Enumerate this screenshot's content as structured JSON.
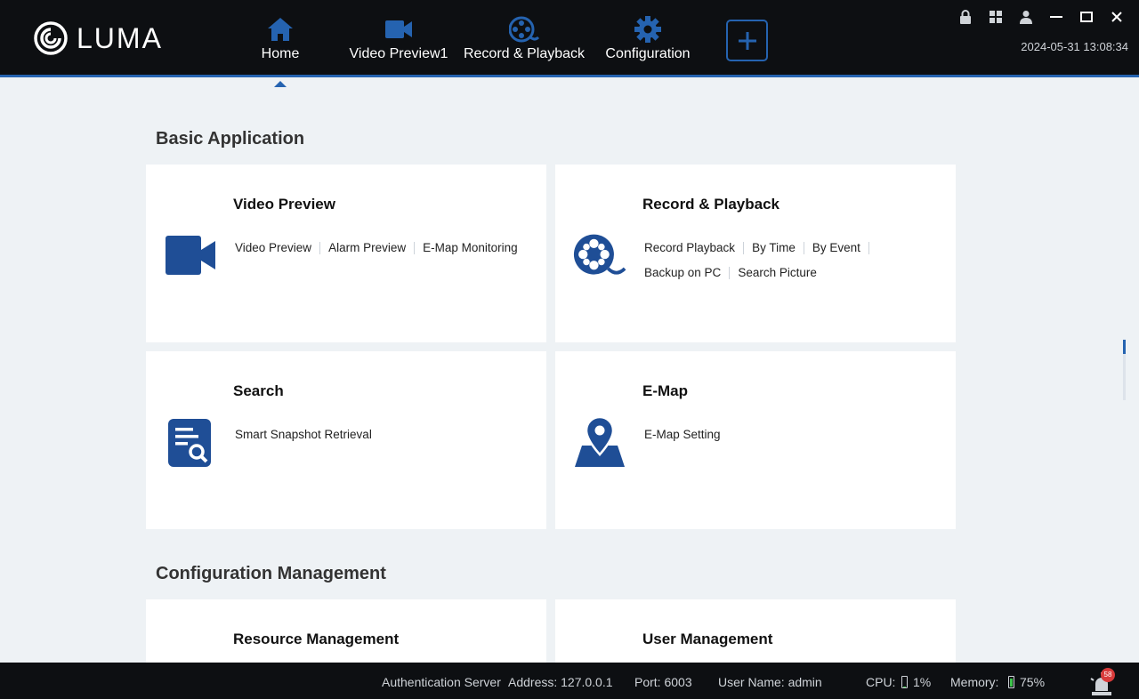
{
  "app": {
    "logo_text": "LUMA"
  },
  "nav": {
    "items": [
      {
        "label": "Home",
        "icon": "home-icon",
        "active": true
      },
      {
        "label": "Video Preview1",
        "icon": "video-camera-icon"
      },
      {
        "label": "Record & Playback",
        "icon": "film-reel-icon"
      },
      {
        "label": "Configuration",
        "icon": "gear-icon"
      }
    ],
    "add_tab_icon": "plus-icon"
  },
  "window_controls": [
    "lock-icon",
    "grid-icon",
    "user-icon",
    "minimize-icon",
    "maximize-icon",
    "close-icon"
  ],
  "datetime": "2024-05-31 13:08:34",
  "sections": {
    "basic": {
      "title": "Basic Application",
      "cards": [
        {
          "title": "Video Preview",
          "icon": "video-camera-icon",
          "links": [
            "Video Preview",
            "Alarm Preview",
            "E-Map Monitoring"
          ]
        },
        {
          "title": "Record & Playback",
          "icon": "film-reel-icon",
          "links": [
            "Record Playback",
            "By Time",
            "By Event",
            "Backup on PC",
            "Search Picture"
          ]
        },
        {
          "title": "Search",
          "icon": "search-document-icon",
          "links": [
            "Smart Snapshot Retrieval"
          ]
        },
        {
          "title": "E-Map",
          "icon": "map-pin-icon",
          "links": [
            "E-Map Setting"
          ]
        }
      ]
    },
    "config": {
      "title": "Configuration Management",
      "cards": [
        {
          "title": "Resource Management"
        },
        {
          "title": "User Management"
        }
      ]
    }
  },
  "status": {
    "auth_server": "Authentication Server",
    "address": "Address: 127.0.0.1",
    "port": "Port: 6003",
    "user": "User Name: admin",
    "cpu_label": "CPU:",
    "cpu_value": "1%",
    "memory_label": "Memory:",
    "memory_value": "75%",
    "alarm_count": "58",
    "cpu_level": 0.01,
    "memory_level": 0.75,
    "memory_color": "#3cc24a"
  },
  "colors": {
    "accent": "#2563b0",
    "icon_blue": "#1f4e96"
  }
}
